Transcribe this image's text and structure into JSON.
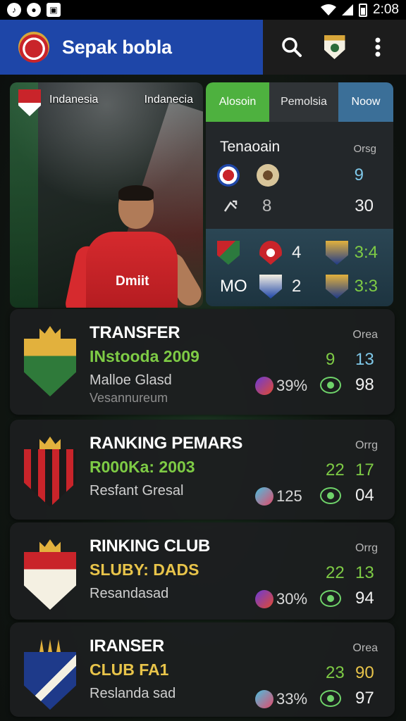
{
  "status_bar": {
    "time": "2:08"
  },
  "app_bar": {
    "title": "Sepak bobla"
  },
  "hero": {
    "label_left": "Indanesia",
    "label_right": "Indanecia",
    "jersey_text": "Dmiit"
  },
  "match_panel": {
    "tabs": [
      "Alosoin",
      "Pemolsia",
      "Noow"
    ],
    "title": "Tenaoain",
    "subtitle": "Orsg",
    "rows": [
      {
        "left": "",
        "mid": "",
        "right": "9"
      },
      {
        "left": "",
        "mid": "8",
        "right": "30"
      }
    ],
    "lower_rows": [
      {
        "label": "",
        "score": "4",
        "right": "3:4"
      },
      {
        "label": "MO",
        "score": "2",
        "right": "3:3"
      }
    ]
  },
  "cards": [
    {
      "title": "TRANSFER",
      "line1": "INstooda 2009",
      "line2": "Malloe Glasd",
      "line3": "Vesannureum",
      "header": "Orea",
      "num1": "9",
      "num2": "13",
      "pct": "39%",
      "num3": "98",
      "line1_color": "#7ecb45",
      "num2_color": "#7ec7e8"
    },
    {
      "title": "RANKING PEMARS",
      "line1": "R000Ka: 2003",
      "line2": "Resfant Gresal",
      "line3": "",
      "header": "Orrg",
      "num1": "22",
      "num2": "17",
      "pct": "125",
      "num3": "04",
      "line1_color": "#7ecb45",
      "num2_color": "#7ecb45"
    },
    {
      "title": "RINKING CLUB",
      "line1": "SLUBY: DADS",
      "line2": "Resandasad",
      "line3": "",
      "header": "Orrg",
      "num1": "22",
      "num2": "13",
      "pct": "30%",
      "num3": "94",
      "line1_color": "#e8c44a",
      "num2_color": "#7ecb45"
    },
    {
      "title": "IRANSER",
      "line1": "CLUB FA1",
      "line2": "Reslanda sad",
      "line3": "",
      "header": "Orea",
      "num1": "23",
      "num2": "90",
      "pct": "33%",
      "num3": "97",
      "line1_color": "#e8c44a",
      "num2_color": "#e8c44a"
    }
  ]
}
